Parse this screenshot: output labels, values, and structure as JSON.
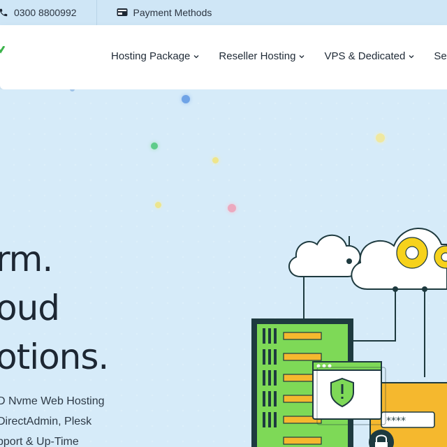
{
  "topbar": {
    "phone": "0300 8800992",
    "payment": "Payment Methods"
  },
  "nav": {
    "items": [
      {
        "label": "Hosting Package"
      },
      {
        "label": "Reseller Hosting"
      },
      {
        "label": "VPS & Dedicated"
      },
      {
        "label": "Se"
      }
    ]
  },
  "hero": {
    "headline": [
      "rm.",
      "oud",
      "otions."
    ],
    "features": [
      "D Nvme Web Hosting",
      "DirectAdmin, Plesk",
      "pport & Up-Time"
    ],
    "password_mask": "****"
  },
  "colors": {
    "accent_green": "#3bb34a",
    "server_green": "#7ed957",
    "server_dark": "#1e3a3f",
    "gear_yellow": "#f6d21c",
    "orange_panel": "#f5b82e",
    "sky": "#d6ebf9"
  },
  "icons": [
    "phone-icon",
    "payment-card-icon",
    "chevron-down-icon",
    "gear-icon",
    "shield-warning-icon",
    "lock-icon",
    "cloud-icon",
    "server-icon"
  ]
}
